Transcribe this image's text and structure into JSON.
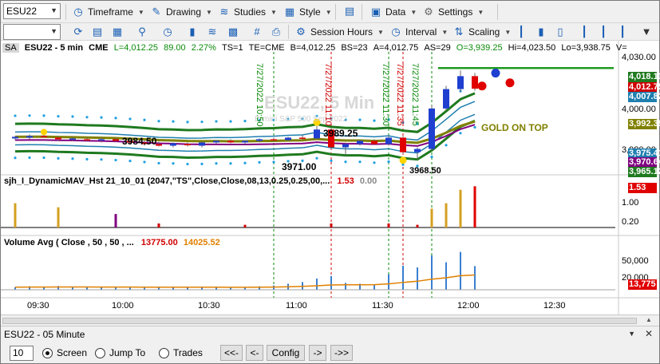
{
  "toolbar": {
    "symbol_combo": "ESU22",
    "timeframe_label": "Timeframe",
    "drawing_label": "Drawing",
    "studies_label": "Studies",
    "style_label": "Style",
    "data_label": "Data",
    "settings_label": "Settings",
    "session_hours_label": "Session Hours",
    "interval_label": "Interval",
    "scaling_label": "Scaling"
  },
  "chart_header": {
    "sa": "SA",
    "symbol": "ESU22 - 5 min",
    "exchange": "CME",
    "last": "L=4,012.25",
    "change": "89.00",
    "change_pct": "2.27%",
    "ts": "TS=1",
    "te": "TE=CME",
    "bid": "B=4,012.25",
    "bs": "BS=23",
    "ask": "A=4,012.75",
    "as": "AS=29",
    "open": "O=3,939.25",
    "high": "Hi=4,023.50",
    "low": "Lo=3,938.75",
    "vol": "V=",
    "up_color": "#0a8a0a",
    "down_color": "#d00000",
    "neutral_color": "#000000"
  },
  "watermark": {
    "symbol": "ESU22, 5 Min",
    "description": "E-mini S&P 500 Sep 2022"
  },
  "annotations": {
    "gold_on_top": "GOLD ON TOP",
    "gold_color": "#808000",
    "price_labels": [
      "3984.50",
      "3989.25",
      "3971.00",
      "3968.50"
    ],
    "vertical_times": [
      {
        "text": "7/27/2022 10:50",
        "color": "#0a8a0a"
      },
      {
        "text": "7/27/2022 11:10",
        "color": "#d00000"
      },
      {
        "text": "7/27/2022 11:30",
        "color": "#0a8a0a"
      },
      {
        "text": "7/27/2022 11:35",
        "color": "#d00000"
      },
      {
        "text": "7/27/2022 11:45",
        "color": "#0a8a0a"
      }
    ]
  },
  "price_axis": {
    "ticks": [
      "4,030.00",
      "4,000.00",
      "3,980.00"
    ],
    "badges": [
      {
        "text": "4,018.11",
        "bg": "#1f7a1f",
        "fg": "#ffffff"
      },
      {
        "text": "4,012.75",
        "bg": "#d00000",
        "fg": "#ffffff"
      },
      {
        "text": "4,007.82",
        "bg": "#1f7fb0",
        "fg": "#ffffff"
      },
      {
        "text": "3,992.39",
        "bg": "#808000",
        "fg": "#ffffff"
      },
      {
        "text": "3,975.41",
        "bg": "#1f7fb0",
        "fg": "#ffffff"
      },
      {
        "text": "3,970.64",
        "bg": "#800080",
        "fg": "#ffffff"
      },
      {
        "text": "3,965.12",
        "bg": "#1f7a1f",
        "fg": "#ffffff"
      }
    ]
  },
  "indicator1": {
    "title": "sjh_I_DynamicMAV_Hst 21_10_01 (2047,\"TS\",Close,Close,08,13,0.25,0.25,00,...",
    "value1": "1.53",
    "value2": "0.00",
    "ticks": [
      "1.00",
      "0.20"
    ],
    "badge": "1.53"
  },
  "indicator2": {
    "title": "Volume Avg ( Close , 50 , 50 , ...",
    "value1": "13775.00",
    "value2": "14025.52",
    "ticks": [
      "50,000",
      "20,000"
    ],
    "badge": "13,775"
  },
  "time_axis": [
    "09:30",
    "10:00",
    "10:30",
    "11:00",
    "11:30",
    "12:00",
    "12:30"
  ],
  "bottom_panel": {
    "title": "ESU22 - 05 Minute",
    "bars_value": "10",
    "radio_screen": "Screen",
    "radio_jump": "Jump To",
    "radio_trades": "Trades",
    "btn_first": "<<-",
    "btn_prev": "<-",
    "btn_config": "Config",
    "btn_next": "->",
    "btn_last": "->>"
  },
  "chart_data": {
    "type": "bar",
    "title": "ESU22, 5 Min",
    "x": [
      "09:20",
      "09:25",
      "09:30",
      "09:35",
      "09:40",
      "09:45",
      "09:50",
      "09:55",
      "10:00",
      "10:05",
      "10:10",
      "10:15",
      "10:20",
      "10:25",
      "10:30",
      "10:35",
      "10:40",
      "10:45",
      "10:50",
      "10:55",
      "11:00",
      "11:05",
      "11:10",
      "11:15",
      "11:20",
      "11:25",
      "11:30",
      "11:35",
      "11:40",
      "11:45",
      "11:50",
      "11:55",
      "12:00"
    ],
    "ohlc": [
      [
        3981.5,
        3983.0,
        3980.5,
        3982.5
      ],
      [
        3982.0,
        3984.0,
        3981.0,
        3983.0
      ],
      [
        3983.0,
        3984.5,
        3982.0,
        3982.5
      ],
      [
        3982.0,
        3983.0,
        3980.0,
        3981.0
      ],
      [
        3981.0,
        3982.5,
        3980.0,
        3981.5
      ],
      [
        3981.0,
        3982.0,
        3979.5,
        3980.5
      ],
      [
        3980.5,
        3982.0,
        3979.0,
        3981.0
      ],
      [
        3981.0,
        3982.0,
        3979.5,
        3980.0
      ],
      [
        3980.0,
        3981.0,
        3978.0,
        3979.0
      ],
      [
        3979.0,
        3980.5,
        3977.0,
        3978.0
      ],
      [
        3978.0,
        3979.5,
        3976.5,
        3977.0
      ],
      [
        3977.0,
        3979.0,
        3976.0,
        3978.5
      ],
      [
        3978.0,
        3979.0,
        3976.5,
        3977.5
      ],
      [
        3977.0,
        3979.5,
        3976.0,
        3979.0
      ],
      [
        3979.0,
        3980.5,
        3978.0,
        3980.0
      ],
      [
        3980.0,
        3981.0,
        3978.5,
        3979.0
      ],
      [
        3979.0,
        3980.5,
        3978.0,
        3980.0
      ],
      [
        3980.0,
        3981.5,
        3979.0,
        3981.0
      ],
      [
        3981.0,
        3982.0,
        3979.5,
        3980.5
      ],
      [
        3980.5,
        3982.5,
        3980.0,
        3982.0
      ],
      [
        3982.0,
        3983.5,
        3980.5,
        3981.5
      ],
      [
        3981.5,
        3989.25,
        3981.0,
        3987.0
      ],
      [
        3987.0,
        3988.0,
        3975.0,
        3976.0
      ],
      [
        3976.0,
        3979.0,
        3971.0,
        3978.0
      ],
      [
        3978.0,
        3981.0,
        3977.0,
        3980.0
      ],
      [
        3980.0,
        3981.0,
        3977.5,
        3978.0
      ],
      [
        3978.0,
        3983.0,
        3977.0,
        3982.0
      ],
      [
        3982.0,
        3983.0,
        3972.0,
        3973.0
      ],
      [
        3973.0,
        3976.0,
        3968.5,
        3975.0
      ],
      [
        3975.0,
        4002.0,
        3974.0,
        4000.0
      ],
      [
        4000.0,
        4014.0,
        3999.0,
        4012.0
      ],
      [
        4012.0,
        4023.5,
        4010.0,
        4020.0
      ],
      [
        4020.0,
        4022.0,
        4011.0,
        4012.25
      ]
    ],
    "series": [
      {
        "name": "4,018.11",
        "values": []
      },
      {
        "name": "4,007.82",
        "values": []
      },
      {
        "name": "3,992.39",
        "values": []
      },
      {
        "name": "3,975.41",
        "values": []
      },
      {
        "name": "3,970.64",
        "values": []
      },
      {
        "name": "3,965.12",
        "values": []
      }
    ],
    "ylim": [
      3960,
      4035
    ],
    "indicator1_values": [
      0.9,
      0.0,
      0.0,
      0.75,
      0.0,
      0.0,
      0.0,
      0.5,
      0.0,
      0.0,
      0.15,
      0.0,
      0.0,
      0.0,
      0.0,
      0.0,
      0.1,
      0.0,
      0.0,
      0.0,
      0.0,
      0.0,
      0.15,
      0.0,
      0.0,
      0.0,
      0.15,
      0.0,
      0.1,
      0.7,
      0.9,
      1.4,
      1.53
    ],
    "volume_values": [
      1500,
      2000,
      1800,
      2200,
      1500,
      1600,
      1400,
      1500,
      1300,
      1200,
      1500,
      1400,
      1300,
      1400,
      1500,
      1300,
      1400,
      2000,
      2500,
      3500,
      4500,
      6500,
      8000,
      4000,
      3500,
      3000,
      9000,
      14000,
      13000,
      20000,
      16000,
      22000,
      13775
    ]
  }
}
